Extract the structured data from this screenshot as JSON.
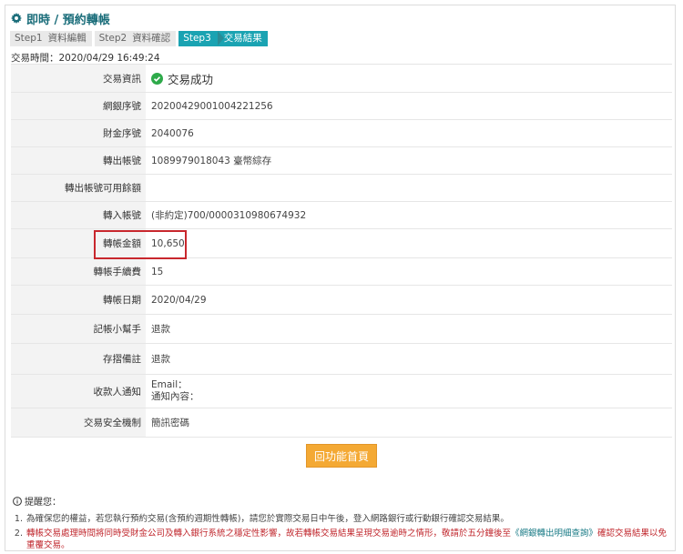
{
  "header": {
    "title": "即時 / 預約轉帳"
  },
  "steps": [
    {
      "num": "Step1",
      "label": "資料編輯",
      "active": false
    },
    {
      "num": "Step2",
      "label": "資料確認",
      "active": false
    },
    {
      "num": "Step3",
      "label": "交易結果",
      "active": true
    }
  ],
  "transaction": {
    "time_text": "交易時間：2020/04/29 16:49:24"
  },
  "rows": [
    {
      "label": "交易資訊",
      "value": "交易成功"
    },
    {
      "label": "網銀序號",
      "value": "20200429001004221256"
    },
    {
      "label": "財金序號",
      "value": "2040076"
    },
    {
      "label": "轉出帳號",
      "value": "1089979018043 臺幣綜存"
    },
    {
      "label": "轉出帳號可用餘額",
      "value": ""
    },
    {
      "label": "轉入帳號",
      "value": "(非約定)700/0000310980674932"
    },
    {
      "label": "轉帳金額",
      "value": "10,650"
    },
    {
      "label": "轉帳手續費",
      "value": "15"
    },
    {
      "label": "轉帳日期",
      "value": "2020/04/29"
    },
    {
      "label": "記帳小幫手",
      "value": "退款"
    },
    {
      "label": "存摺備註",
      "value": "退款"
    },
    {
      "label": "收款人通知",
      "value_line1": "Email：",
      "value_line2": "通知內容："
    },
    {
      "label": "交易安全機制",
      "value": "簡訊密碼"
    }
  ],
  "actions": {
    "home_label": "回功能首頁"
  },
  "notes": {
    "title": "提醒您：",
    "item1_num": "1.",
    "item1": "為確保您的權益，若您執行預約交易(含預約週期性轉帳)，請您於實際交易日中午後，登入網路銀行或行動銀行確認交易結果。",
    "item2_num": "2.",
    "item2_a": "轉帳交易處理時間將同時受財金公司及轉入銀行系統之穩定性影響，故若轉帳交易結果呈現交易逾時之情形，敬請於五分鐘後至",
    "item2_link": "《網銀轉出明細查詢》",
    "item2_b": "確認交易結果以免重覆交易。"
  },
  "colors": {
    "accent": "#1aa3b2",
    "title": "#1a6d7a",
    "button": "#f4a934",
    "warning": "#c0272d",
    "success": "#2eaa4a",
    "highlight": "#c8272d"
  }
}
